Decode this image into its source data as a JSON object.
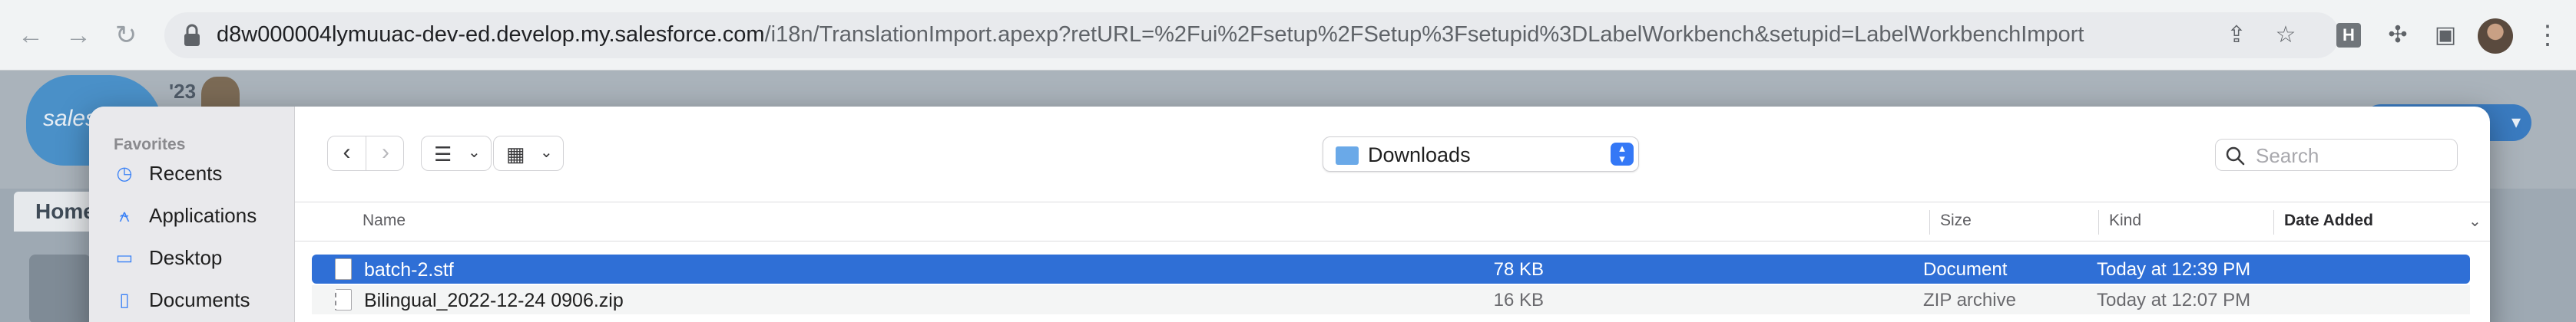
{
  "browser": {
    "url_host": "d8w000004lymuuac-dev-ed.develop.my.salesforce.com",
    "url_path": "/i18n/TranslationImport.apexp?retURL=%2Fui%2Fsetup%2FSetup%3Fsetupid%3DLabelWorkbench&setupid=LabelWorkbenchImport",
    "extension_letter": "H"
  },
  "salesforce": {
    "cloud_text": "sales",
    "release_badge": "'23",
    "nav_home": "Home"
  },
  "dialog": {
    "sidebar": {
      "heading": "Favorites",
      "items": [
        {
          "label": "Recents",
          "icon": "clock-icon"
        },
        {
          "label": "Applications",
          "icon": "applications-icon"
        },
        {
          "label": "Desktop",
          "icon": "desktop-icon"
        },
        {
          "label": "Documents",
          "icon": "document-icon"
        }
      ]
    },
    "location": "Downloads",
    "search_placeholder": "Search",
    "columns": {
      "name": "Name",
      "size": "Size",
      "kind": "Kind",
      "date_added": "Date Added"
    },
    "files": [
      {
        "name": "batch-2.stf",
        "size": "78 KB",
        "kind": "Document",
        "date_added": "Today at 12:39 PM",
        "selected": true
      },
      {
        "name": "Bilingual_2022-12-24 0906.zip",
        "size": "16 KB",
        "kind": "ZIP archive",
        "date_added": "Today at 12:07 PM",
        "selected": false
      }
    ]
  },
  "colors": {
    "selection": "#2f6fd6",
    "accent": "#3478f6"
  }
}
